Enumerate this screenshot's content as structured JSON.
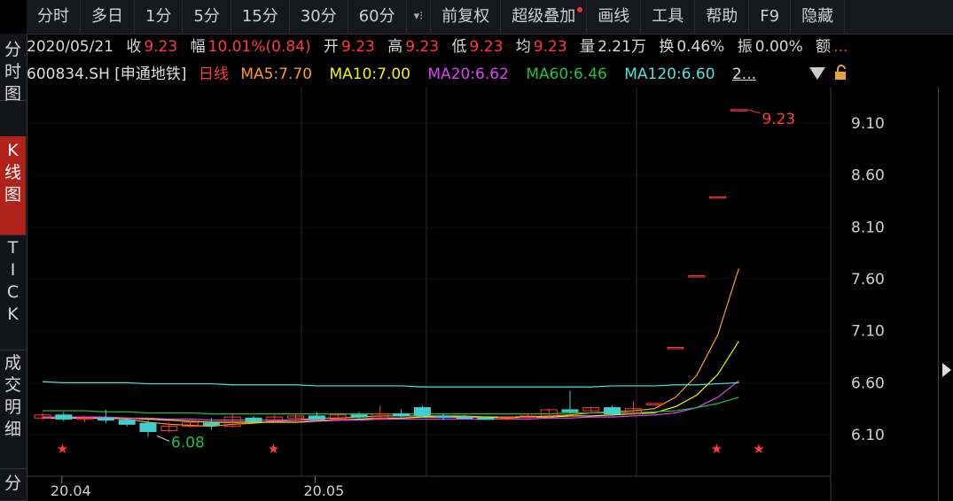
{
  "tabs": [
    "分时",
    "多日",
    "1分",
    "5分",
    "15分",
    "30分",
    "60分",
    "▾⁝",
    "前复权",
    "超级叠加",
    "画线",
    "工具",
    "帮助",
    "F9",
    "隐藏"
  ],
  "sidebar": [
    "分\n时\n图",
    "K\n线\n图",
    "T\nI\nC\nK",
    "成\n交\n明\n细",
    "分"
  ],
  "info": {
    "date": "2020/05/21",
    "close_label": "收",
    "close": "9.23",
    "change_label": "幅",
    "change": "10.01%(0.84)",
    "open_label": "开",
    "open": "9.23",
    "high_label": "高",
    "high": "9.23",
    "low_label": "低",
    "low": "9.23",
    "avg_label": "均",
    "avg": "9.23",
    "vol_label": "量",
    "vol": "2.21万",
    "turnover_label": "换",
    "turnover": "0.46%",
    "amp_label": "振",
    "amp": "0.00%",
    "amount_label": "额",
    "amount": "..."
  },
  "ma": {
    "symbol": "600834.SH [申通地铁]",
    "period": "日线",
    "ma5": "MA5:7.70",
    "ma10": "MA10:7.00",
    "ma20": "MA20:6.62",
    "ma60": "MA60:6.46",
    "ma120": "MA120:6.60",
    "more": "2..."
  },
  "colors": {
    "up": "#ff3b3b",
    "down": "#3fcfcf",
    "ma5": "#ff9a1f",
    "ma10": "#f4f10a",
    "ma20": "#e040fb",
    "ma60": "#20c040",
    "ma120": "#50e0e0",
    "grid": "#2c2c2c",
    "text": "#cfcfcf"
  },
  "chart_data": {
    "type": "candlestick",
    "ylim": [
      5.7,
      9.45
    ],
    "y_ticks": [
      "9.10",
      "8.60",
      "8.10",
      "7.60",
      "7.10",
      "6.60",
      "6.10"
    ],
    "x_ticks": [
      "20.04",
      "20.05"
    ],
    "x_tick_index": [
      1,
      13
    ],
    "max_label": "9.23",
    "min_label": "6.08",
    "candles": [
      {
        "o": 6.26,
        "h": 6.31,
        "l": 6.24,
        "c": 6.29
      },
      {
        "o": 6.29,
        "h": 6.32,
        "l": 6.23,
        "c": 6.25
      },
      {
        "o": 6.25,
        "h": 6.28,
        "l": 6.22,
        "c": 6.26
      },
      {
        "o": 6.26,
        "h": 6.34,
        "l": 6.21,
        "c": 6.24
      },
      {
        "o": 6.24,
        "h": 6.26,
        "l": 6.18,
        "c": 6.2
      },
      {
        "o": 6.21,
        "h": 6.24,
        "l": 6.08,
        "c": 6.13
      },
      {
        "o": 6.14,
        "h": 6.22,
        "l": 6.12,
        "c": 6.18
      },
      {
        "o": 6.18,
        "h": 6.24,
        "l": 6.17,
        "c": 6.22
      },
      {
        "o": 6.21,
        "h": 6.26,
        "l": 6.15,
        "c": 6.19
      },
      {
        "o": 6.18,
        "h": 6.3,
        "l": 6.17,
        "c": 6.27
      },
      {
        "o": 6.26,
        "h": 6.28,
        "l": 6.21,
        "c": 6.23
      },
      {
        "o": 6.23,
        "h": 6.29,
        "l": 6.22,
        "c": 6.27
      },
      {
        "o": 6.26,
        "h": 6.3,
        "l": 6.22,
        "c": 6.28
      },
      {
        "o": 6.28,
        "h": 6.32,
        "l": 6.24,
        "c": 6.25
      },
      {
        "o": 6.25,
        "h": 6.31,
        "l": 6.23,
        "c": 6.29
      },
      {
        "o": 6.29,
        "h": 6.32,
        "l": 6.25,
        "c": 6.27
      },
      {
        "o": 6.26,
        "h": 6.38,
        "l": 6.24,
        "c": 6.3
      },
      {
        "o": 6.3,
        "h": 6.34,
        "l": 6.26,
        "c": 6.28
      },
      {
        "o": 6.36,
        "h": 6.38,
        "l": 6.27,
        "c": 6.28
      },
      {
        "o": 6.28,
        "h": 6.3,
        "l": 6.24,
        "c": 6.27
      },
      {
        "o": 6.27,
        "h": 6.29,
        "l": 6.25,
        "c": 6.26
      },
      {
        "o": 6.26,
        "h": 6.28,
        "l": 6.24,
        "c": 6.25
      },
      {
        "o": 6.25,
        "h": 6.28,
        "l": 6.24,
        "c": 6.27
      },
      {
        "o": 6.27,
        "h": 6.3,
        "l": 6.25,
        "c": 6.28
      },
      {
        "o": 6.28,
        "h": 6.35,
        "l": 6.26,
        "c": 6.34
      },
      {
        "o": 6.34,
        "h": 6.52,
        "l": 6.3,
        "c": 6.32
      },
      {
        "o": 6.33,
        "h": 6.37,
        "l": 6.3,
        "c": 6.36
      },
      {
        "o": 6.36,
        "h": 6.38,
        "l": 6.28,
        "c": 6.3
      },
      {
        "o": 6.3,
        "h": 6.42,
        "l": 6.29,
        "c": 6.35
      },
      {
        "o": 6.4,
        "h": 6.4,
        "l": 6.4,
        "c": 6.4
      },
      {
        "o": 6.94,
        "h": 6.94,
        "l": 6.94,
        "c": 6.94
      },
      {
        "o": 7.63,
        "h": 7.63,
        "l": 7.63,
        "c": 7.63
      },
      {
        "o": 8.39,
        "h": 8.39,
        "l": 8.39,
        "c": 8.39
      },
      {
        "o": 9.23,
        "h": 9.23,
        "l": 9.23,
        "c": 9.23
      }
    ],
    "series": [
      {
        "name": "MA5",
        "values": [
          6.27,
          6.27,
          6.26,
          6.26,
          6.25,
          6.22,
          6.2,
          6.19,
          6.18,
          6.2,
          6.21,
          6.23,
          6.24,
          6.26,
          6.26,
          6.27,
          6.28,
          6.28,
          6.28,
          6.28,
          6.28,
          6.27,
          6.26,
          6.27,
          6.28,
          6.29,
          6.31,
          6.32,
          6.33,
          6.35,
          6.46,
          6.67,
          7.06,
          7.7
        ]
      },
      {
        "name": "MA10",
        "values": [
          6.26,
          6.26,
          6.26,
          6.26,
          6.26,
          6.25,
          6.24,
          6.23,
          6.22,
          6.22,
          6.22,
          6.22,
          6.22,
          6.23,
          6.24,
          6.25,
          6.26,
          6.26,
          6.27,
          6.27,
          6.27,
          6.27,
          6.27,
          6.27,
          6.27,
          6.28,
          6.28,
          6.29,
          6.3,
          6.31,
          6.37,
          6.48,
          6.68,
          7.0
        ]
      },
      {
        "name": "MA20",
        "values": [
          6.27,
          6.27,
          6.27,
          6.27,
          6.26,
          6.26,
          6.25,
          6.25,
          6.24,
          6.24,
          6.24,
          6.24,
          6.24,
          6.24,
          6.24,
          6.24,
          6.25,
          6.25,
          6.25,
          6.25,
          6.25,
          6.25,
          6.25,
          6.25,
          6.26,
          6.26,
          6.27,
          6.27,
          6.28,
          6.29,
          6.31,
          6.36,
          6.46,
          6.62
        ]
      },
      {
        "name": "MA60",
        "values": [
          6.33,
          6.33,
          6.33,
          6.32,
          6.32,
          6.31,
          6.31,
          6.31,
          6.3,
          6.3,
          6.3,
          6.3,
          6.3,
          6.3,
          6.3,
          6.3,
          6.3,
          6.3,
          6.3,
          6.3,
          6.3,
          6.3,
          6.3,
          6.3,
          6.3,
          6.31,
          6.31,
          6.31,
          6.31,
          6.32,
          6.33,
          6.36,
          6.4,
          6.46
        ]
      },
      {
        "name": "MA120",
        "values": [
          6.61,
          6.6,
          6.6,
          6.6,
          6.6,
          6.59,
          6.59,
          6.59,
          6.59,
          6.58,
          6.58,
          6.58,
          6.58,
          6.57,
          6.57,
          6.57,
          6.57,
          6.57,
          6.56,
          6.56,
          6.56,
          6.56,
          6.56,
          6.56,
          6.56,
          6.56,
          6.56,
          6.57,
          6.57,
          6.57,
          6.58,
          6.58,
          6.59,
          6.6
        ]
      }
    ],
    "marker_index": [
      1,
      11,
      32,
      34
    ]
  }
}
